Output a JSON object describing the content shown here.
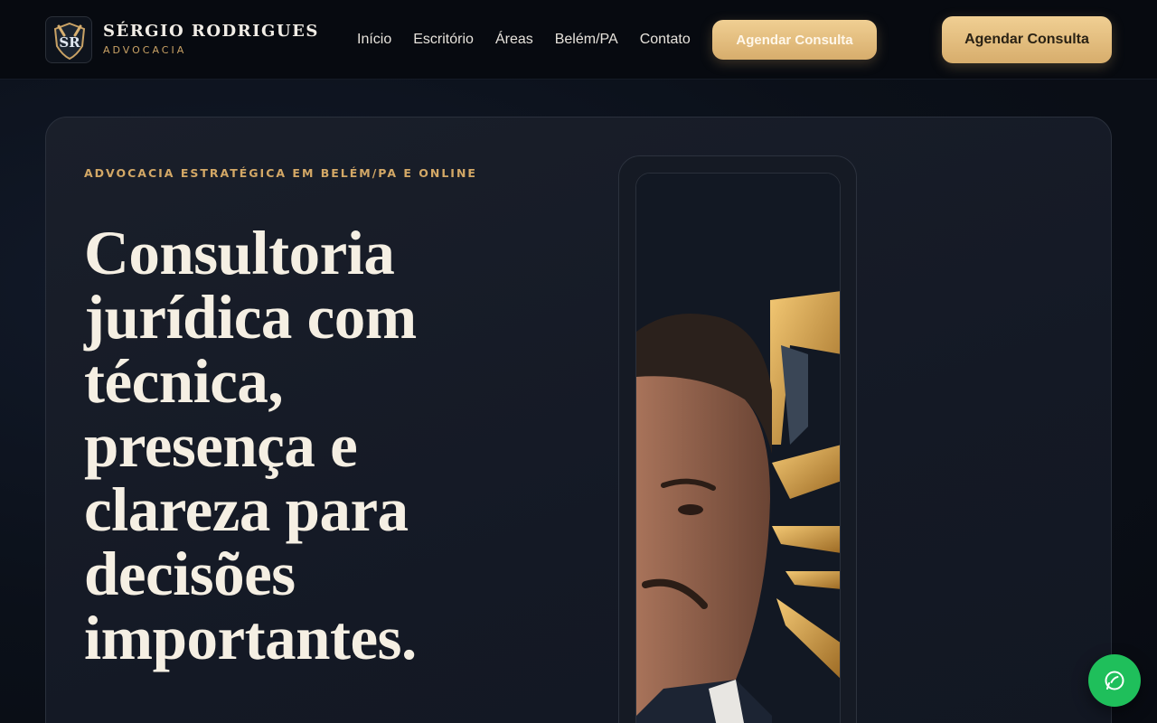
{
  "header": {
    "brand_name": "SÉRGIO RODRIGUES",
    "brand_sub": "ADVOCACIA",
    "logo_monogram": "SR",
    "nav": [
      {
        "label": "Início"
      },
      {
        "label": "Escritório"
      },
      {
        "label": "Áreas"
      },
      {
        "label": "Belém/PA"
      },
      {
        "label": "Contato"
      }
    ],
    "nav_cta_label": "Agendar Consulta",
    "header_cta_label": "Agendar Consulta"
  },
  "hero": {
    "eyebrow": "ADVOCACIA ESTRATÉGICA EM BELÉM/PA E ONLINE",
    "headline": "Consultoria jurídica com técnica, presença e clareza para decisões importantes.",
    "portrait_image": "lawyer-portrait-with-gold-crest"
  },
  "floating": {
    "whatsapp_icon": "whatsapp-icon"
  },
  "colors": {
    "accent_gold": "#d7ad6c",
    "background": "#0b1019",
    "whatsapp_green": "#1fbf5b"
  }
}
